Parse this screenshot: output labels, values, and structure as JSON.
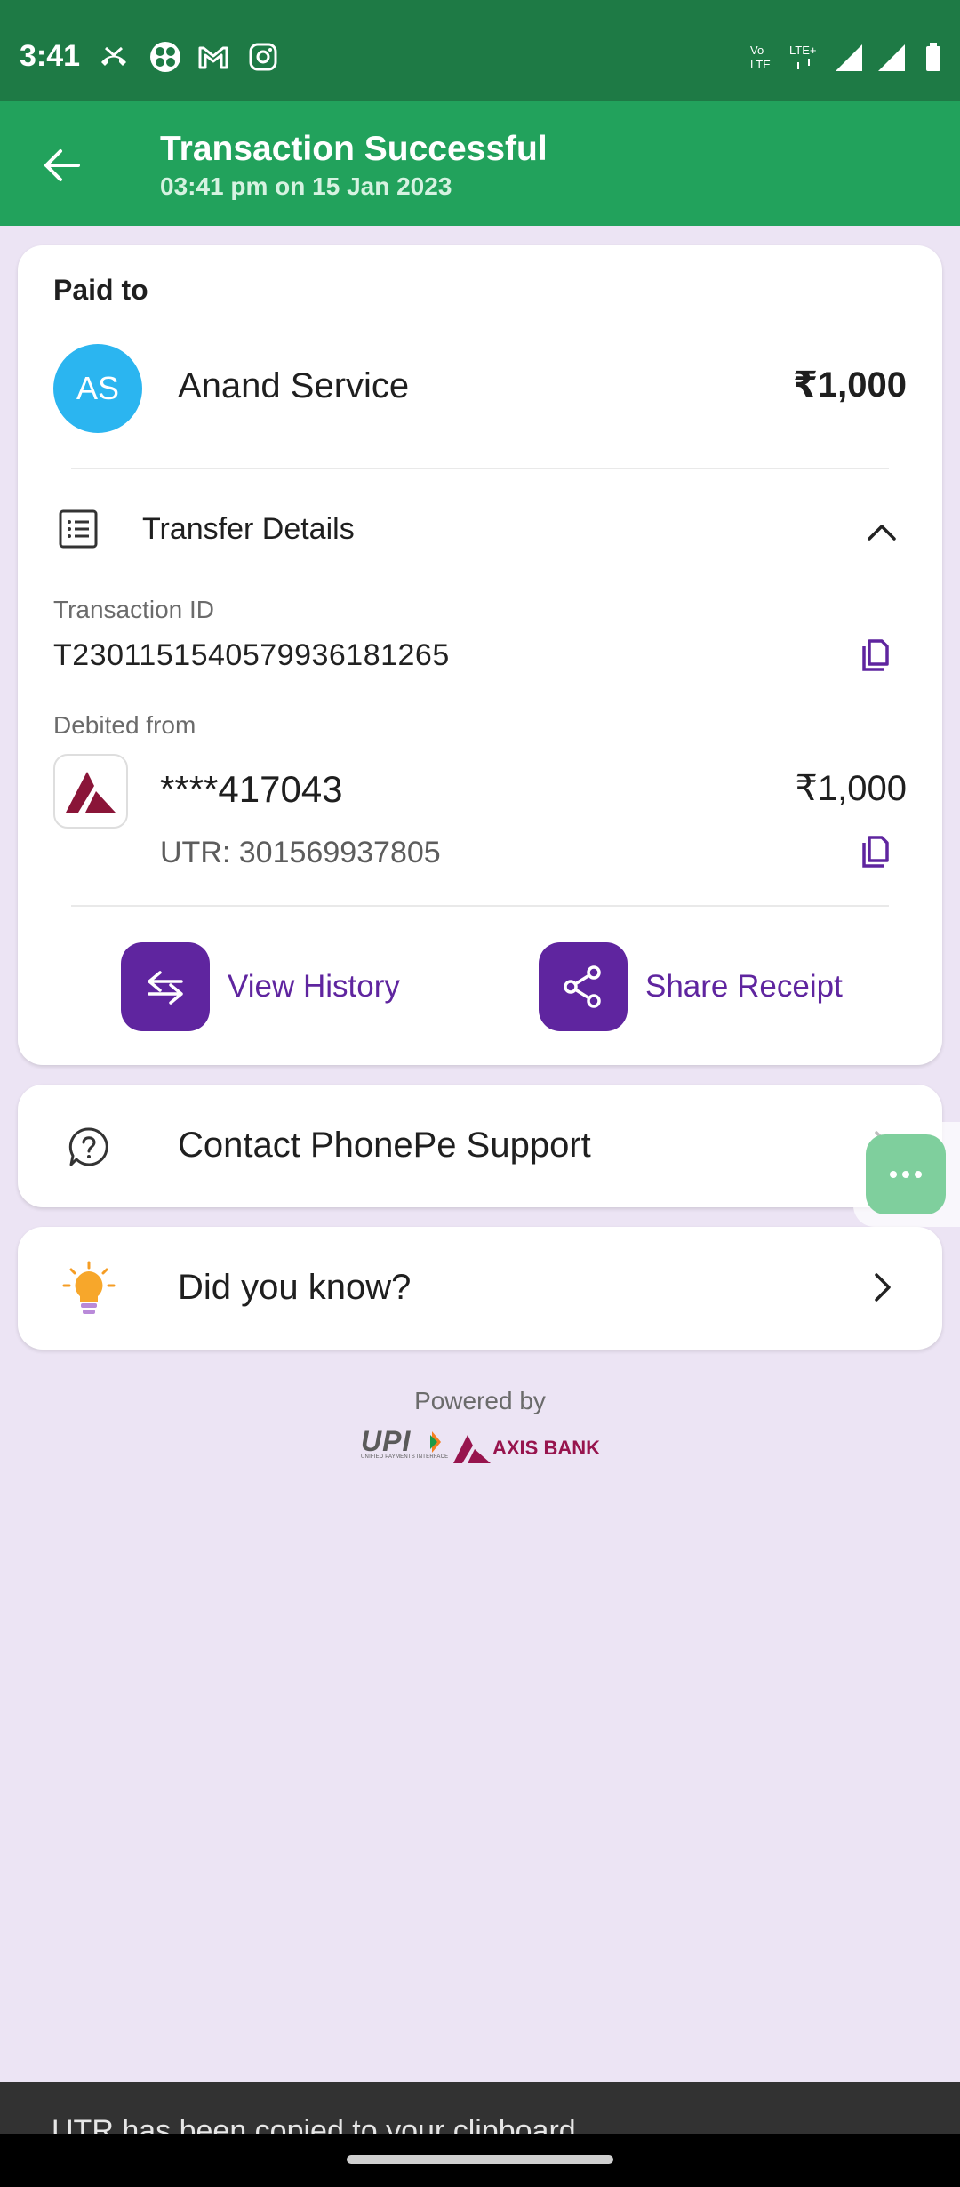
{
  "status_bar": {
    "time": "3:41",
    "notification_icons": [
      "missed-call-icon",
      "pinwheel-icon",
      "gmail-icon",
      "instagram-icon"
    ],
    "system_icons": [
      "volte-icon",
      "lte-plus-icon",
      "signal-icon",
      "signal-icon",
      "battery-icon"
    ]
  },
  "app_bar": {
    "title": "Transaction Successful",
    "subtitle": "03:41 pm on 15 Jan 2023"
  },
  "payment": {
    "paid_to_label": "Paid to",
    "avatar_initials": "AS",
    "payee_name": "Anand Service",
    "amount": "₹1,000"
  },
  "transfer_details": {
    "label": "Transfer Details",
    "transaction_id_label": "Transaction ID",
    "transaction_id": "T2301151540579936181265",
    "debited_from_label": "Debited from",
    "account": "****417043",
    "account_amount": "₹1,000",
    "utr": "UTR: 301569937805"
  },
  "actions": {
    "view_history": "View History",
    "share_receipt": "Share Receipt"
  },
  "support": {
    "label": "Contact PhonePe Support"
  },
  "did_you_know": {
    "label": "Did you know?"
  },
  "footer": {
    "powered_by": "Powered by",
    "upi_logo": "UPI",
    "upi_tagline": "UNIFIED PAYMENTS INTERFACE",
    "bank_logo": "AXIS BANK"
  },
  "snackbar": {
    "text": "UTR has been copied to your clipboard"
  },
  "colors": {
    "status_bar": "#1e7a45",
    "app_bar": "#22a25c",
    "accent_purple": "#5f259f",
    "background": "#ece4f4",
    "avatar": "#2bb5f0",
    "axis_maroon": "#97144d"
  }
}
